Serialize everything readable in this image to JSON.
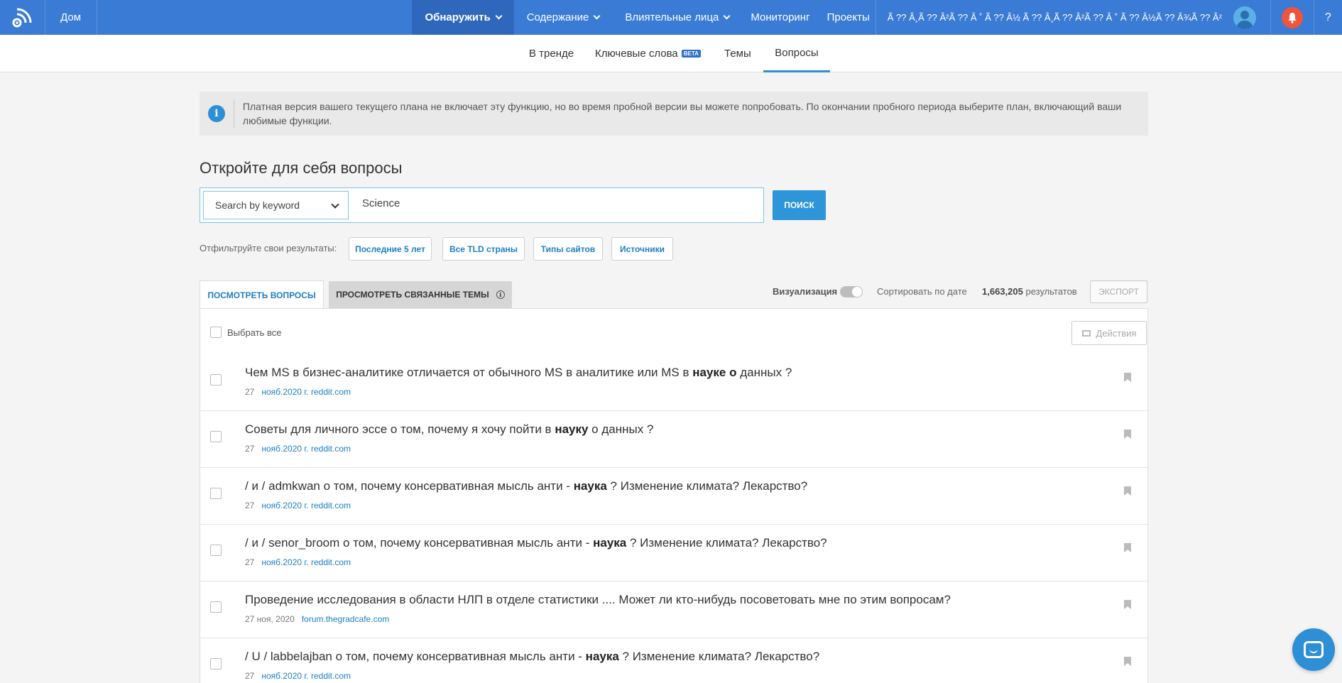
{
  "nav": {
    "home": "Дом",
    "discover": "Обнаружить",
    "content": "Содержание",
    "influencers": "Влиятельные лица",
    "monitoring": "Мониторинг",
    "projects": "Проекты",
    "account_name": "Ã ?? Â¸Ã ?? Â²Ã ?? Â ˚ Ã ?? Â½ Ã ?? Â¸Ã ?? Â²Ã ?? Â ˚ Ã ?? Â½Ã ?? Â¾Ã ?? Â²",
    "help": "?"
  },
  "subnav": {
    "trending": "В тренде",
    "keywords": "Ключевые слова",
    "keywords_badge": "BETA",
    "topics": "Темы",
    "questions": "Вопросы"
  },
  "banner": {
    "icon": "i",
    "text": "Платная версия вашего текущего плана не включает эту функцию, но во время пробной версии вы можете попробовать. По окончании пробного периода выберите план, включающий ваши любимые функции."
  },
  "page_title": "Откройте для себя вопросы",
  "search": {
    "mode": "Search by keyword",
    "query": "Science",
    "button": "ПОИСК"
  },
  "filters": {
    "label": "Отфильтруйте свои результаты:",
    "items": [
      "Последние 5 лет",
      "Все TLD страны",
      "Типы сайтов",
      "Источники"
    ]
  },
  "results_tabs": {
    "questions": "ПОСМОТРЕТЬ ВОПРОСЫ",
    "related": "ПРОСМОТРЕТЬ СВЯЗАННЫЕ ТЕМЫ",
    "related_info": "i"
  },
  "controls": {
    "visualization": "Визуализация",
    "sort": "Сортировать по дате",
    "count_number": "1,663,205",
    "count_label": "результатов",
    "export": "ЭКСПОРТ"
  },
  "panel": {
    "select_all": "Выбрать все",
    "actions": "Действия"
  },
  "rows": [
    {
      "pre": "Чем MS в бизнес-аналитике отличается от обычного MS в аналитике или MS в ",
      "bold": "науке о",
      "post": " данных ?",
      "date": "27",
      "source": "нояб.2020 г. reddit.com"
    },
    {
      "pre": "Советы для личного эссе о том, почему я хочу пойти в ",
      "bold": "науку",
      "post": " о данных ?",
      "date": "27",
      "source": "нояб.2020 г. reddit.com"
    },
    {
      "pre": "/ и / admkwan о том, почему консервативная мысль анти - ",
      "bold": "наука",
      "post": " ? Изменение климата? Лекарство?",
      "date": "27",
      "source": "нояб.2020 г. reddit.com"
    },
    {
      "pre": "/ и / senor_broom о том, почему консервативная мысль анти - ",
      "bold": "наука",
      "post": " ? Изменение климата? Лекарство?",
      "date": "27",
      "source": "нояб.2020 г. reddit.com"
    },
    {
      "pre": "Проведение исследования в области НЛП в отделе статистики .... Может ли кто-нибудь посоветовать мне по этим вопросам?",
      "bold": "",
      "post": "",
      "date": "27 ноя, 2020",
      "source": "forum.thegradcafe.com"
    },
    {
      "pre": "/ U / labbelajban о том, почему консервативная мысль анти - ",
      "bold": "наука",
      "post": " ? Изменение климата? Лекарство?",
      "date": "27",
      "source": "нояб.2020 г. reddit.com"
    }
  ],
  "colors": {
    "nav_bg": "#3a7bd5",
    "accent": "#2d95d8",
    "link": "#1d7fc4",
    "bell": "#f0543c"
  }
}
